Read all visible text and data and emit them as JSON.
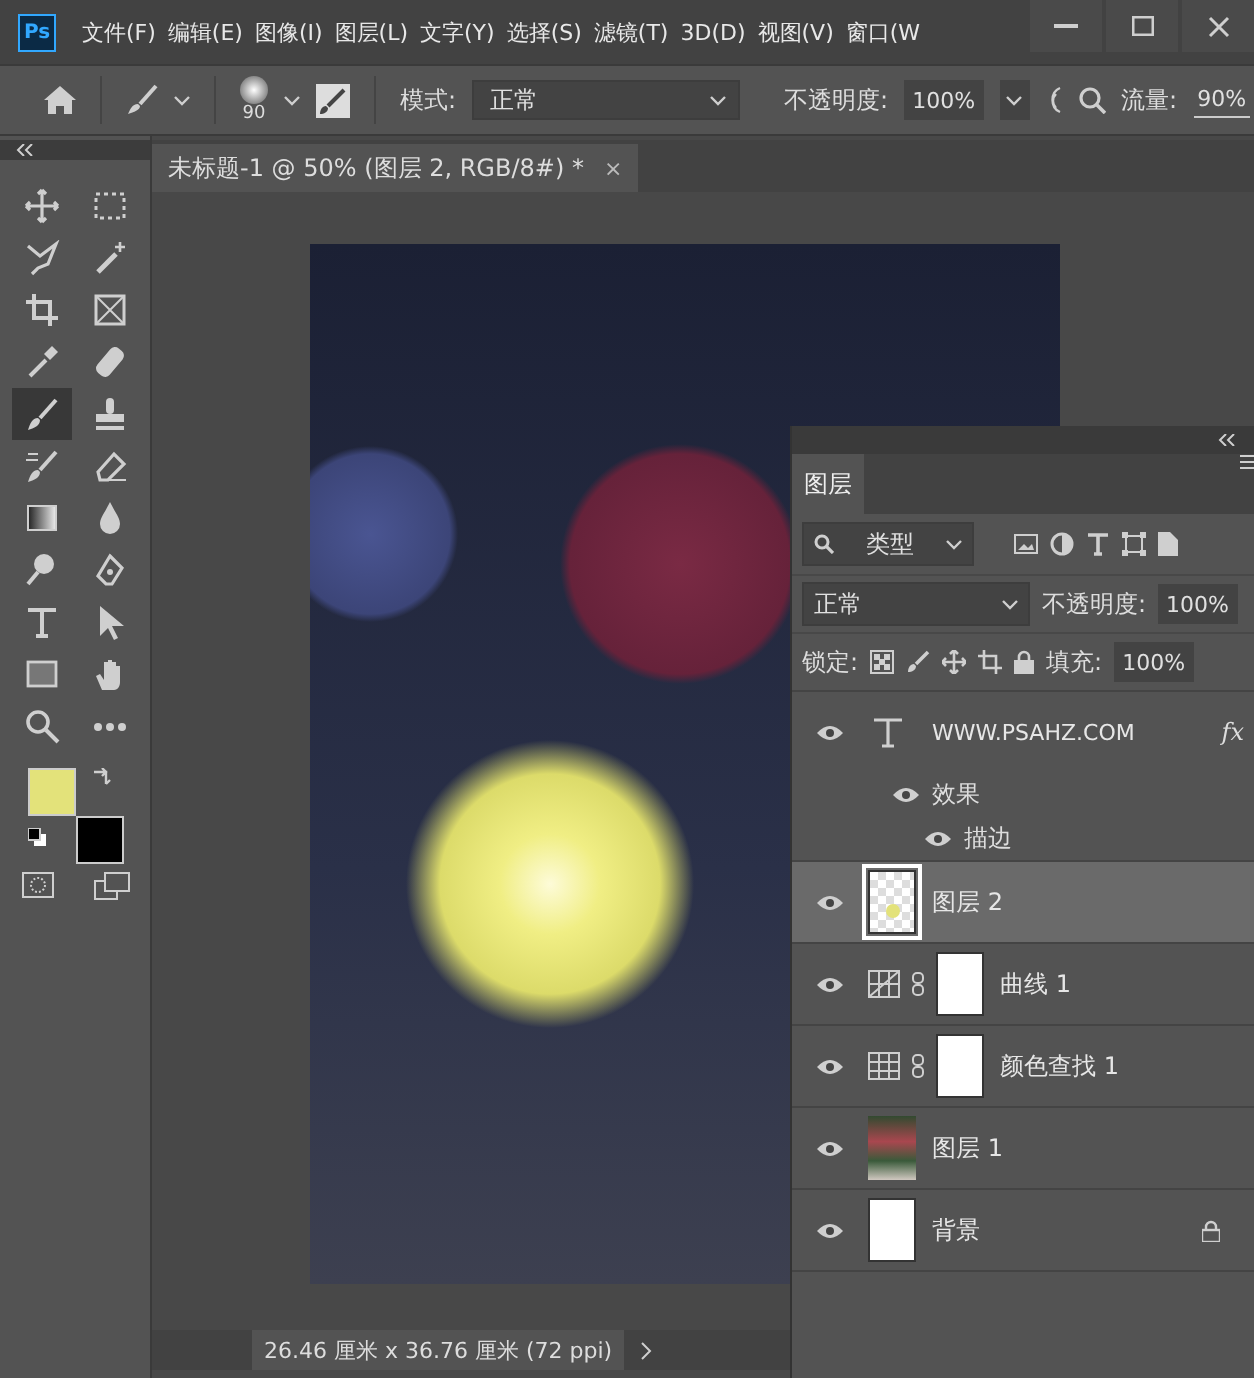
{
  "app_logo": "Ps",
  "menu": [
    "文件(F)",
    "编辑(E)",
    "图像(I)",
    "图层(L)",
    "文字(Y)",
    "选择(S)",
    "滤镜(T)",
    "3D(D)",
    "视图(V)",
    "窗口(W"
  ],
  "options_bar": {
    "brush_size": "90",
    "mode_label": "模式:",
    "mode": "正常",
    "opacity_label": "不透明度:",
    "opacity": "100%",
    "flow_label": "流量:",
    "flow": "90%"
  },
  "document_tab": {
    "title": "未标题-1 @ 50% (图层 2, RGB/8#) *",
    "close": "×"
  },
  "tools": [
    {
      "selected": false
    },
    {
      "selected": false
    },
    {
      "selected": false
    },
    {
      "selected": false
    },
    {
      "selected": false
    },
    {
      "selected": false
    },
    {
      "selected": false
    },
    {
      "selected": false
    },
    {
      "selected": true
    },
    {
      "selected": false
    },
    {
      "selected": false
    },
    {
      "selected": false
    },
    {
      "selected": false
    },
    {
      "selected": false
    },
    {
      "selected": false
    },
    {
      "selected": false
    },
    {
      "selected": false
    },
    {
      "selected": false
    },
    {
      "selected": false
    },
    {
      "selected": false
    },
    {
      "selected": false
    },
    {
      "selected": false
    }
  ],
  "swatches": [
    {
      "color": "#e3e27a"
    },
    {
      "color": "#000000"
    }
  ],
  "status_bar": {
    "document_size": "26.46 厘米 x 36.76 厘米 (72 ppi)"
  },
  "layers_panel": {
    "tab": "图层",
    "filter": "类型",
    "blend_mode": "正常",
    "opacity_label": "不透明度:",
    "opacity": "100%",
    "lock_label": "锁定:",
    "fill_label": "填充:",
    "fill": "100%",
    "layers": [
      {
        "kind": "text",
        "name": "WWW.PSAHZ.COM",
        "visible": true,
        "selected": false,
        "locked": false,
        "fx": "fx",
        "effects": [
          {
            "label": "效果",
            "visible": true,
            "children": [
              {
                "label": "描边",
                "visible": true
              }
            ]
          }
        ]
      },
      {
        "kind": "pixel",
        "name": "图层 2",
        "visible": true,
        "selected": true,
        "locked": false
      },
      {
        "kind": "curves",
        "name": "曲线 1",
        "visible": true,
        "selected": false,
        "locked": false
      },
      {
        "kind": "lookup",
        "name": "颜色查找 1",
        "visible": true,
        "selected": false,
        "locked": false
      },
      {
        "kind": "photo",
        "name": "图层 1",
        "visible": true,
        "selected": false,
        "locked": false
      },
      {
        "kind": "background",
        "name": "背景",
        "visible": true,
        "selected": false,
        "locked": true
      }
    ]
  }
}
